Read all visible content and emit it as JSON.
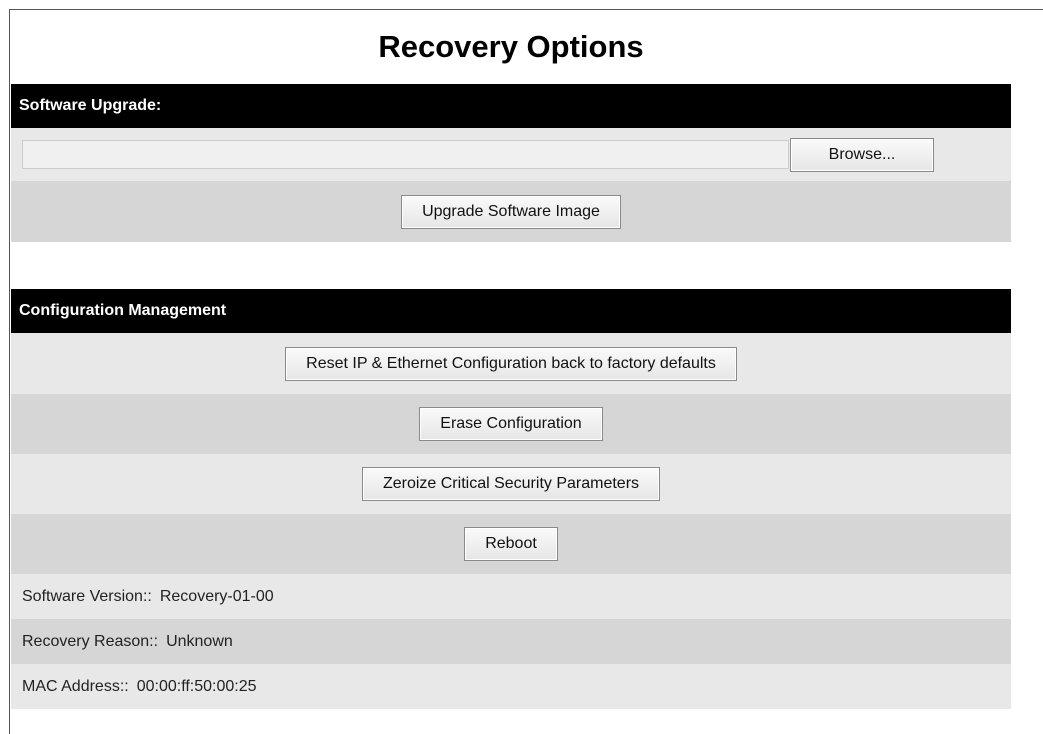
{
  "page": {
    "title": "Recovery Options"
  },
  "software_upgrade": {
    "header": "Software Upgrade:",
    "file_input_value": "",
    "browse_label": "Browse...",
    "upgrade_label": "Upgrade Software Image"
  },
  "config_management": {
    "header": "Configuration Management",
    "reset_label": "Reset IP & Ethernet Configuration back to factory defaults",
    "erase_label": "Erase Configuration",
    "zeroize_label": "Zeroize Critical Security Parameters",
    "reboot_label": "Reboot"
  },
  "info": {
    "software_version_label": "Software Version::",
    "software_version_value": "Recovery-01-00",
    "recovery_reason_label": "Recovery Reason::",
    "recovery_reason_value": "Unknown",
    "mac_address_label": "MAC Address::",
    "mac_address_value": "00:00:ff:50:00:25"
  },
  "colors": {
    "header_bg": "#000000",
    "header_text": "#ffffff",
    "row_light": "#e8e8e8",
    "row_dark": "#d6d6d6"
  }
}
